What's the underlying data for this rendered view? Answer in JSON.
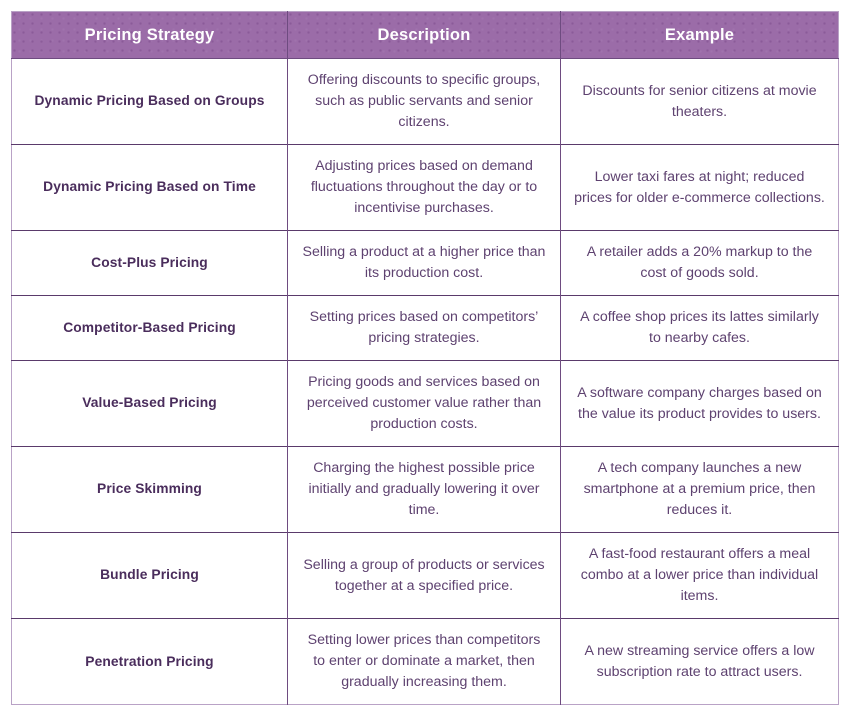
{
  "table": {
    "columns": [
      {
        "key": "strategy",
        "label": "Pricing Strategy"
      },
      {
        "key": "description",
        "label": "Description"
      },
      {
        "key": "example",
        "label": "Example"
      }
    ],
    "rows": [
      {
        "strategy": "Dynamic Pricing Based on Groups",
        "description": "Offering discounts to specific groups, such as public servants and senior citizens.",
        "example": "Discounts for senior citizens at movie theaters."
      },
      {
        "strategy": "Dynamic Pricing Based on Time",
        "description": "Adjusting prices based on demand fluctuations throughout the day or to incentivise purchases.",
        "example": "Lower taxi fares at night; reduced prices for older e-commerce collections."
      },
      {
        "strategy": "Cost-Plus Pricing",
        "description": "Selling a product at a higher price than its production cost.",
        "example": "A retailer adds a 20% markup to the cost of goods sold."
      },
      {
        "strategy": "Competitor-Based Pricing",
        "description": "Setting prices based on competitors’ pricing strategies.",
        "example": "A coffee shop prices its lattes similarly to nearby cafes."
      },
      {
        "strategy": "Value-Based Pricing",
        "description": "Pricing goods and services based on perceived customer value rather than production costs.",
        "example": "A software company charges based on the value its product provides to users."
      },
      {
        "strategy": "Price Skimming",
        "description": "Charging the highest possible price initially and gradually lowering it over time.",
        "example": "A tech company launches a new smartphone at a premium price, then reduces it."
      },
      {
        "strategy": "Bundle Pricing",
        "description": "Selling a group of products or services together at a specified price.",
        "example": "A fast-food restaurant offers a meal combo at a lower price than individual items."
      },
      {
        "strategy": "Penetration Pricing",
        "description": "Setting lower prices than competitors to enter or dominate a market, then gradually increasing them.",
        "example": "A new streaming service offers a low subscription rate to attract users."
      }
    ]
  },
  "colors": {
    "header_background": "#9b6ca8",
    "header_text": "#ffffff",
    "outer_border": "#b9a2c6",
    "inner_border": "#6e4b80",
    "row_divider": "#5a3a6b",
    "strategy_text": "#4a2d5c",
    "body_text": "#5e4270",
    "page_background": "#ffffff"
  }
}
